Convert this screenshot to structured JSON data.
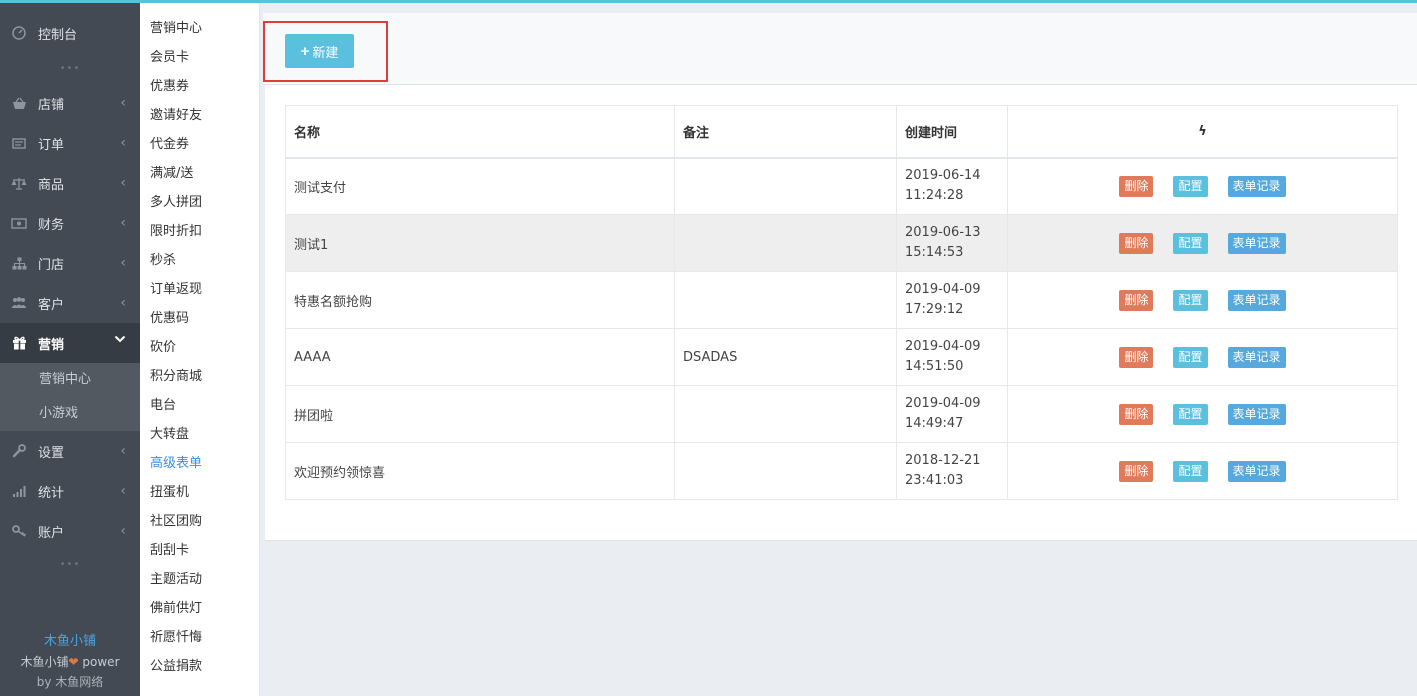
{
  "colors": {
    "accent": "#5bc0de",
    "sidebar_bg": "#434a54",
    "delete": "#e07a5a",
    "config": "#5bc0de",
    "records": "#55a9dc",
    "highlight": "#e03c3c"
  },
  "sidebar": {
    "dashboard": {
      "label": "控制台",
      "icon": "dashboard-icon"
    },
    "items": [
      {
        "label": "店铺",
        "icon": "shop-basket-icon"
      },
      {
        "label": "订单",
        "icon": "order-icon"
      },
      {
        "label": "商品",
        "icon": "scale-icon"
      },
      {
        "label": "财务",
        "icon": "money-icon"
      },
      {
        "label": "门店",
        "icon": "sitemap-icon"
      },
      {
        "label": "客户",
        "icon": "users-icon"
      },
      {
        "label": "营销",
        "icon": "gift-icon"
      }
    ],
    "marketing_sub": [
      "营销中心",
      "小游戏"
    ],
    "items_after": [
      {
        "label": "设置",
        "icon": "wrench-icon"
      },
      {
        "label": "统计",
        "icon": "signal-icon"
      },
      {
        "label": "账户",
        "icon": "key-icon"
      }
    ],
    "footer": {
      "brand": "木鱼小铺",
      "power_prefix": "木鱼小铺",
      "power_suffix": "power",
      "by": "by 木鱼网络"
    }
  },
  "submenu": [
    "营销中心",
    "会员卡",
    "优惠券",
    "邀请好友",
    "代金券",
    "满减/送",
    "多人拼团",
    "限时折扣",
    "秒杀",
    "订单返现",
    "优惠码",
    "砍价",
    "积分商城",
    "电台",
    "大转盘",
    "高级表单",
    "扭蛋机",
    "社区团购",
    "刮刮卡",
    "主题活动",
    "佛前供灯",
    "祈愿忏悔",
    "公益捐款"
  ],
  "toolbar": {
    "new_label": "新建"
  },
  "table": {
    "headers": {
      "name": "名称",
      "note": "备注",
      "created": "创建时间"
    },
    "rows": [
      {
        "name": "测试支付",
        "note": "",
        "date": "2019-06-14",
        "time": "11:24:28"
      },
      {
        "name": "测试1",
        "note": "",
        "date": "2019-06-13",
        "time": "15:14:53"
      },
      {
        "name": "特惠名额抢购",
        "note": "",
        "date": "2019-04-09",
        "time": "17:29:12"
      },
      {
        "name": "AAAA",
        "note": "DSADAS",
        "date": "2019-04-09",
        "time": "14:51:50"
      },
      {
        "name": "拼团啦",
        "note": "",
        "date": "2019-04-09",
        "time": "14:49:47"
      },
      {
        "name": "欢迎预约领惊喜",
        "note": "",
        "date": "2018-12-21",
        "time": "23:41:03"
      }
    ],
    "actions": {
      "delete": "删除",
      "config": "配置",
      "records": "表单记录"
    }
  }
}
